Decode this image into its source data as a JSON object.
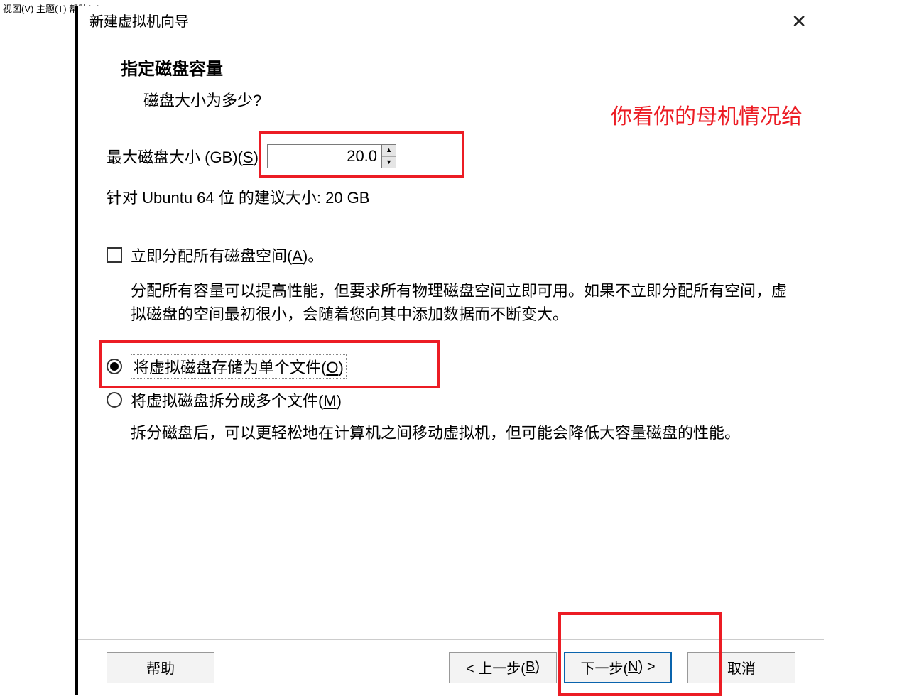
{
  "menu_fragment": "视图(V)  主题(T)  帮助(H)",
  "titlebar": {
    "title": "新建虚拟机向导"
  },
  "header": {
    "title": "指定磁盘容量",
    "subtitle": "磁盘大小为多少?"
  },
  "annotation": "你看你的母机情况给",
  "disk": {
    "label_pre": "最大磁盘大小 (GB)(",
    "label_hotkey": "S",
    "label_post": "):",
    "value": "20.0",
    "recommend_pre": "针对 ",
    "recommend_os": "Ubuntu 64 位",
    "recommend_post": " 的建议大小: 20 GB"
  },
  "allocate": {
    "label_pre": "立即分配所有磁盘空间(",
    "label_hotkey": "A",
    "label_post": ")。",
    "desc": "分配所有容量可以提高性能，但要求所有物理磁盘空间立即可用。如果不立即分配所有空间，虚拟磁盘的空间最初很小，会随着您向其中添加数据而不断变大。"
  },
  "storage": {
    "single_pre": "将虚拟磁盘存储为单个文件(",
    "single_hotkey": "O",
    "single_post": ")",
    "split_pre": "将虚拟磁盘拆分成多个文件(",
    "split_hotkey": "M",
    "split_post": ")",
    "split_desc": "拆分磁盘后，可以更轻松地在计算机之间移动虚拟机，但可能会降低大容量磁盘的性能。"
  },
  "footer": {
    "help": "帮助",
    "back_pre": "< 上一步(",
    "back_hotkey": "B",
    "back_post": ")",
    "next_pre": "下一步(",
    "next_hotkey": "N",
    "next_post": ") >",
    "cancel": "取消"
  }
}
